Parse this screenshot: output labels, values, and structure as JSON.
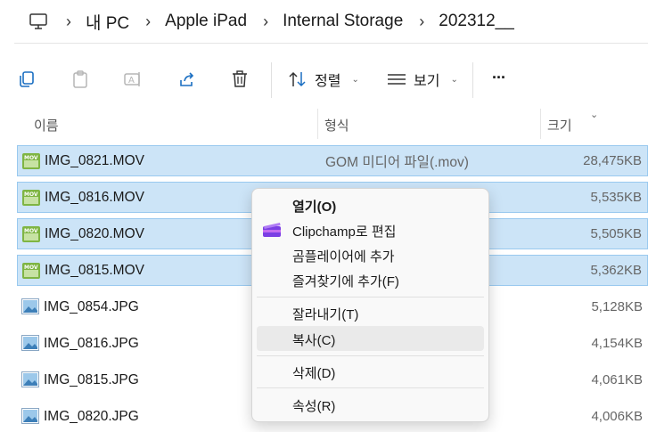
{
  "address": {
    "crumbs": [
      "내 PC",
      "Apple iPad",
      "Internal Storage",
      "202312__"
    ]
  },
  "toolbar": {
    "sort_label": "정렬",
    "view_label": "보기",
    "more_label": "..."
  },
  "columns": {
    "name": "이름",
    "type": "형식",
    "size": "크기"
  },
  "files": [
    {
      "name": "IMG_0821.MOV",
      "type": "GOM 미디어 파일(.mov)",
      "size": "28,475KB",
      "kind": "mov",
      "selected": true
    },
    {
      "name": "IMG_0816.MOV",
      "type": "",
      "size": "5,535KB",
      "kind": "mov",
      "selected": true
    },
    {
      "name": "IMG_0820.MOV",
      "type": "",
      "size": "5,505KB",
      "kind": "mov",
      "selected": true
    },
    {
      "name": "IMG_0815.MOV",
      "type": "",
      "size": "5,362KB",
      "kind": "mov",
      "selected": true
    },
    {
      "name": "IMG_0854.JPG",
      "type": "",
      "size": "5,128KB",
      "kind": "jpg",
      "selected": false
    },
    {
      "name": "IMG_0816.JPG",
      "type": "",
      "size": "4,154KB",
      "kind": "jpg",
      "selected": false
    },
    {
      "name": "IMG_0815.JPG",
      "type": "",
      "size": "4,061KB",
      "kind": "jpg",
      "selected": false
    },
    {
      "name": "IMG_0820.JPG",
      "type": "",
      "size": "4,006KB",
      "kind": "jpg",
      "selected": false
    }
  ],
  "context_menu": {
    "open": "열기(O)",
    "edit_clipchamp": "Clipchamp로 편집",
    "add_gom_player": "곰플레이어에 추가",
    "add_favorites": "즐겨찾기에 추가(F)",
    "cut": "잘라내기(T)",
    "copy": "복사(C)",
    "delete": "삭제(D)",
    "properties": "속성(R)"
  },
  "colors": {
    "selection_bg": "#cce4f7",
    "selection_border": "#99c9ef",
    "accent": "#0067c0"
  },
  "icons": [
    "pc-icon",
    "copy-path-icon",
    "paste-icon",
    "rename-icon",
    "share-icon",
    "delete-icon",
    "sort-icon",
    "view-icon",
    "mov-file-icon",
    "jpg-file-icon",
    "clipchamp-icon"
  ]
}
